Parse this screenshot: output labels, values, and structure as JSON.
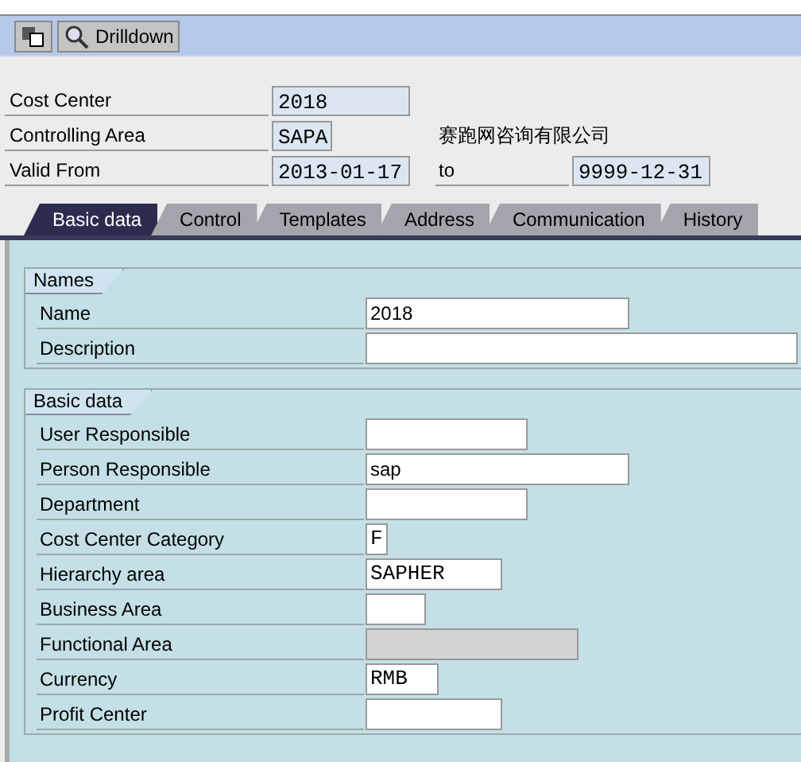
{
  "toolbar": {
    "buttons": [
      {
        "kind": "icon"
      },
      {
        "kind": "labeled",
        "label": "Drilldown"
      }
    ]
  },
  "header": {
    "rows": [
      {
        "label": "Cost Center",
        "value": "2018"
      },
      {
        "label": "Controlling Area",
        "value": "SAPA",
        "note": "赛跑网咨询有限公司"
      },
      {
        "label": "Valid From",
        "value": "2013-01-17",
        "to_label": "to",
        "to_value": "9999-12-31"
      }
    ]
  },
  "tabs": [
    {
      "label": "Basic data",
      "selected": true
    },
    {
      "label": "Control",
      "selected": false
    },
    {
      "label": "Templates",
      "selected": false
    },
    {
      "label": "Address",
      "selected": false
    },
    {
      "label": "Communication",
      "selected": false
    },
    {
      "label": "History",
      "selected": false
    }
  ],
  "groups": [
    {
      "title": "Names",
      "fields": [
        {
          "label": "Name",
          "value": "2018",
          "disabled": false
        },
        {
          "label": "Description",
          "disabled": false
        }
      ]
    },
    {
      "title": "Basic data",
      "fields": [
        {
          "label": "User Responsible",
          "disabled": false
        },
        {
          "label": "Person Responsible",
          "value": "sap",
          "disabled": false
        },
        {
          "label": "Department",
          "disabled": false
        },
        {
          "label": "Cost Center Category",
          "value": "F",
          "disabled": false
        },
        {
          "label": "Hierarchy area",
          "value": "SAPHER",
          "disabled": false
        },
        {
          "label": "Business Area",
          "disabled": false
        },
        {
          "label": "Functional Area",
          "disabled": true
        },
        {
          "label": "Currency",
          "value": "RMB",
          "disabled": false
        },
        {
          "label": "Profit Center",
          "disabled": false
        }
      ]
    }
  ]
}
